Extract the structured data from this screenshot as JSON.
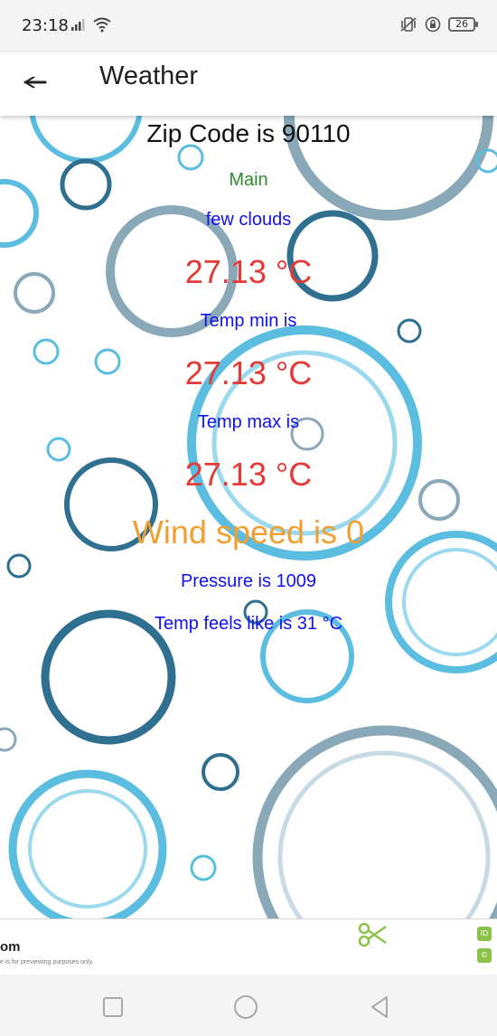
{
  "status_bar": {
    "time": "23:18",
    "battery": "26"
  },
  "app_bar": {
    "title": "Weather"
  },
  "weather": {
    "zip_line": "Zip Code is 90110",
    "main_label": "Main",
    "description": "few clouds",
    "temperature": "27.13  °C",
    "temp_min_label": "Temp min is",
    "temp_min": "27.13  °C",
    "temp_max_label": "Temp max is",
    "temp_max": "27.13  °C",
    "wind_line": "Wind speed is 0",
    "pressure_line": "Pressure is 1009",
    "feels_like_line": "Temp feels like is  31  °C"
  },
  "ad": {
    "domain": "om",
    "disclaimer": "e is for previewing purposes only.",
    "marks": [
      "ID",
      "©"
    ]
  },
  "colors": {
    "zip": "#111111",
    "main": "#2e8b2e",
    "blue_text": "#1111ee",
    "temperature": "#e53935",
    "wind": "#f0a030",
    "bubble_light": "#5bbde0",
    "bubble_dark": "#2f6f8f",
    "bubble_gray": "#8aa9b8"
  }
}
